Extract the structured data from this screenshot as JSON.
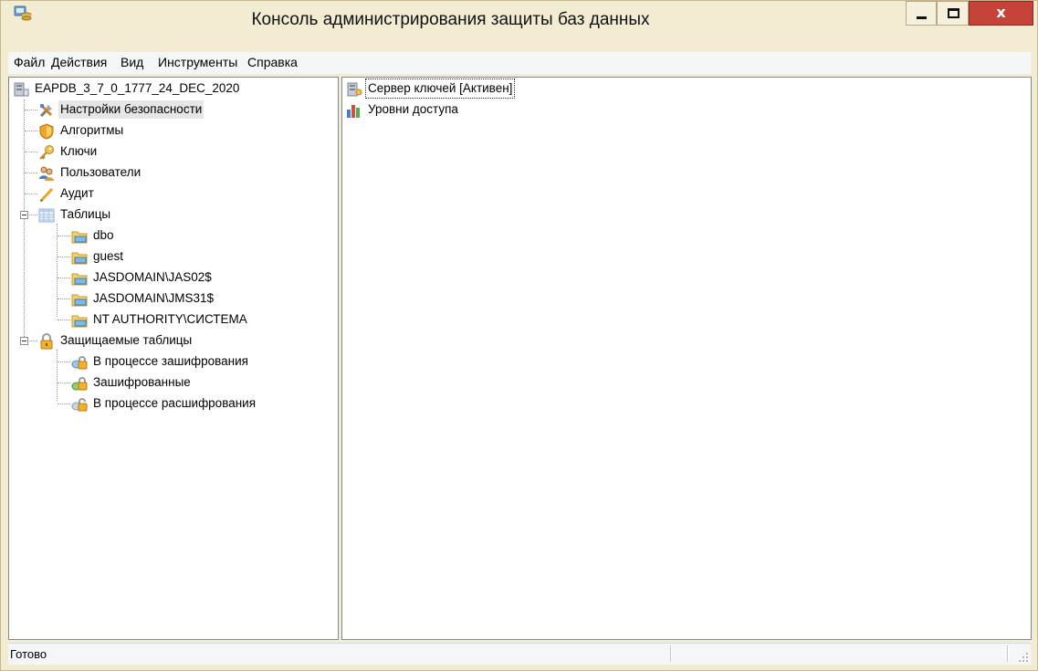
{
  "window": {
    "title": "Консоль администрирования защиты баз данных",
    "app_icon": "database-console-icon",
    "controls": {
      "minimize": "minimize-icon",
      "maximize": "maximize-icon",
      "close": "x"
    },
    "colors": {
      "frame": "#f2ecd2",
      "close_button": "#c6433a"
    }
  },
  "menu": {
    "items": [
      {
        "label": "Файл"
      },
      {
        "label": "Действия"
      },
      {
        "label": "Вид"
      },
      {
        "label": "Инструменты"
      },
      {
        "label": "Справка"
      }
    ]
  },
  "tree": {
    "root": {
      "label": "EAPDB_3_7_0_1777_24_DEC_2020",
      "icon": "database-server-icon"
    },
    "items": [
      {
        "label": "Настройки безопасности",
        "icon": "tools-icon",
        "selected": true
      },
      {
        "label": "Алгоритмы",
        "icon": "shield-icon"
      },
      {
        "label": "Ключи",
        "icon": "key-icon"
      },
      {
        "label": "Пользователи",
        "icon": "users-icon"
      },
      {
        "label": "Аудит",
        "icon": "pencil-icon"
      },
      {
        "label": "Таблицы",
        "icon": "table-icon",
        "expanded": true
      },
      {
        "label": "dbo",
        "icon": "schema-folder-icon"
      },
      {
        "label": "guest",
        "icon": "schema-folder-icon"
      },
      {
        "label": "JASDOMAIN\\JAS02$",
        "icon": "schema-folder-icon"
      },
      {
        "label": "JASDOMAIN\\JMS31$",
        "icon": "schema-folder-icon"
      },
      {
        "label": "NT AUTHORITY\\СИСТЕМА",
        "icon": "schema-folder-icon"
      },
      {
        "label": "Защищаемые таблицы",
        "icon": "padlock-icon",
        "expanded": true
      },
      {
        "label": "В процессе зашифрования",
        "icon": "encrypting-lock-icon"
      },
      {
        "label": "Зашифрованные",
        "icon": "encrypted-lock-icon"
      },
      {
        "label": "В процессе расшифрования",
        "icon": "decrypting-lock-icon"
      }
    ]
  },
  "details": {
    "items": [
      {
        "label": "Сервер ключей [Активен]",
        "icon": "key-server-icon",
        "focused": true
      },
      {
        "label": "Уровни доступа",
        "icon": "access-levels-chart-icon"
      }
    ]
  },
  "status": {
    "text": "Готово"
  }
}
